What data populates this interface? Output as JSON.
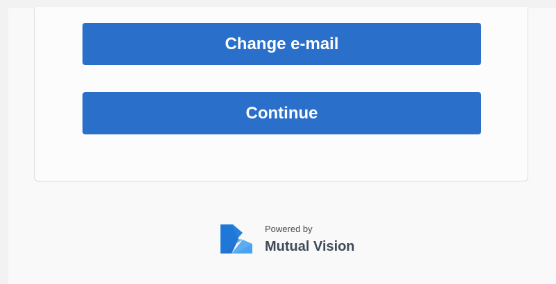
{
  "actions": {
    "change_email_label": "Change e-mail",
    "continue_label": "Continue"
  },
  "footer": {
    "powered_by": "Powered by",
    "brand_name": "Mutual Vision",
    "logo_icon": "mutual-vision-logo"
  },
  "colors": {
    "button_bg": "#2a6fc9",
    "button_text": "#ffffff",
    "logo_primary": "#1f78d8",
    "logo_secondary": "#4aa3f0"
  }
}
